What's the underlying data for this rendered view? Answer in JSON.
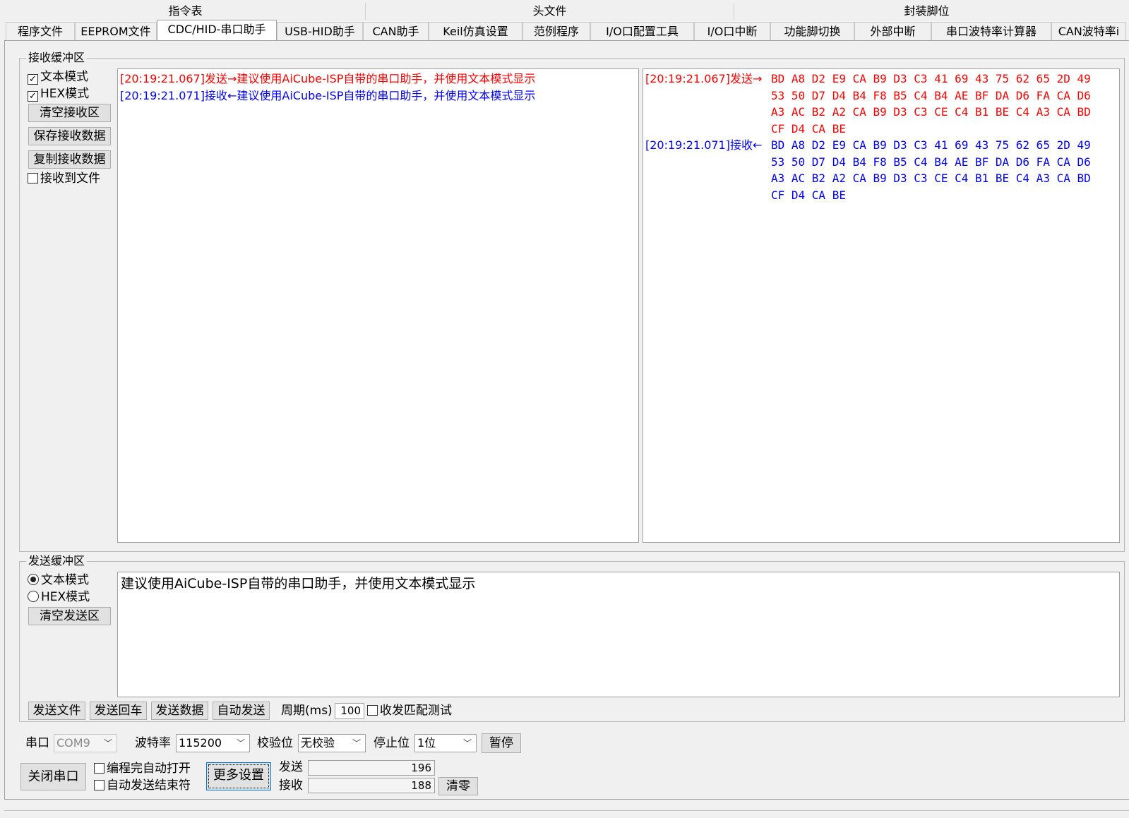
{
  "categories": [
    "指令表",
    "头文件",
    "封装脚位"
  ],
  "tabs": [
    "程序文件",
    "EEPROM文件",
    "CDC/HID-串口助手",
    "USB-HID助手",
    "CAN助手",
    "Keil仿真设置",
    "范例程序",
    "I/O口配置工具",
    "I/O口中断",
    "功能脚切换",
    "外部中断",
    "串口波特率计算器",
    "CAN波特率i"
  ],
  "receive": {
    "legend": "接收缓冲区",
    "text_mode": "文本模式",
    "hex_mode": "HEX模式",
    "clear_btn": "清空接收区",
    "save_btn": "保存接收数据",
    "copy_btn": "复制接收数据",
    "to_file": "接收到文件",
    "text_lines": [
      {
        "prefix": "[20:19:21.067]发送→",
        "text": "建议使用AiCube-ISP自带的串口助手，并使用文本模式显示"
      },
      {
        "prefix": "[20:19:21.071]接收←",
        "text": "建议使用AiCube-ISP自带的串口助手，并使用文本模式显示"
      }
    ],
    "hex_lines": [
      {
        "prefix": "[20:19:21.067]发送→",
        "rows": [
          "BD A8 D2 E9 CA B9 D3 C3 41 69 43 75 62 65 2D 49",
          "53 50 D7 D4 B4 F8 B5 C4 B4 AE BF DA D6 FA CA D6",
          "A3 AC B2 A2 CA B9 D3 C3 CE C4 B1 BE C4 A3 CA BD",
          "CF D4 CA BE"
        ]
      },
      {
        "prefix": "[20:19:21.071]接收←",
        "rows": [
          "BD A8 D2 E9 CA B9 D3 C3 41 69 43 75 62 65 2D 49",
          "53 50 D7 D4 B4 F8 B5 C4 B4 AE BF DA D6 FA CA D6",
          "A3 AC B2 A2 CA B9 D3 C3 CE C4 B1 BE C4 A3 CA BD",
          "CF D4 CA BE"
        ]
      }
    ]
  },
  "send": {
    "legend": "发送缓冲区",
    "text_mode": "文本模式",
    "hex_mode": "HEX模式",
    "clear_btn": "清空发送区",
    "content": "建议使用AiCube-ISP自带的串口助手，并使用文本模式显示",
    "send_file_btn": "发送文件",
    "send_enter_btn": "发送回车",
    "send_data_btn": "发送数据",
    "auto_send_btn": "自动发送",
    "period_label": "周期(ms)",
    "period_value": "100",
    "match_test": "收发匹配测试"
  },
  "port": {
    "port_label": "串口",
    "port_value": "COM9",
    "baud_label": "波特率",
    "baud_value": "115200",
    "parity_label": "校验位",
    "parity_value": "无校验",
    "stop_label": "停止位",
    "stop_value": "1位",
    "pause_btn": "暂停",
    "close_btn": "关闭串口",
    "auto_open": "编程完自动打开",
    "auto_end": "自动发送结束符",
    "more_btn": "更多设置",
    "sent_label": "发送",
    "sent_count": "196",
    "recv_label": "接收",
    "recv_count": "188",
    "reset_btn": "清零"
  }
}
